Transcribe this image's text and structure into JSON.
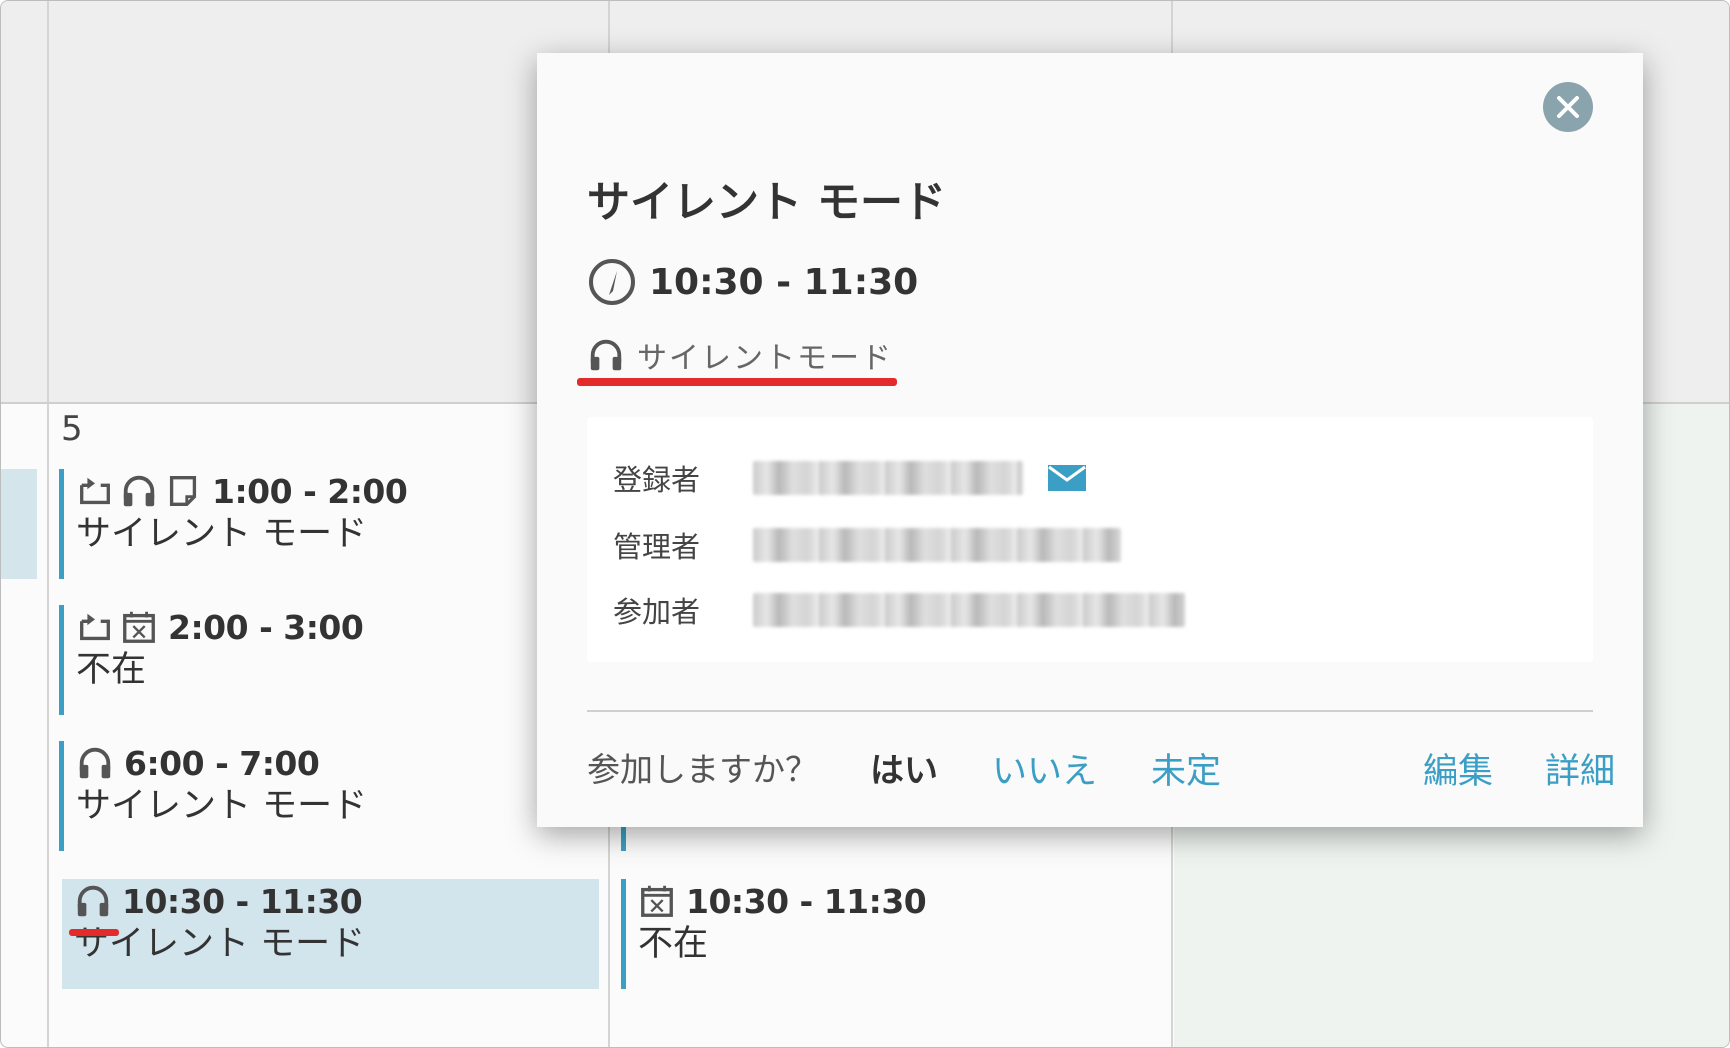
{
  "calendar": {
    "day_number": "5",
    "events_col1": [
      {
        "time": "1:00 - 2:00",
        "title": "サイレント モード",
        "icons": [
          "repeat-icon",
          "headphones-icon",
          "memo-icon"
        ]
      },
      {
        "time": "2:00 - 3:00",
        "title": "不在",
        "icons": [
          "repeat-icon",
          "calendar-x-icon"
        ]
      },
      {
        "time": "6:00 - 7:00",
        "title": "サイレント モード",
        "icons": [
          "headphones-icon"
        ]
      },
      {
        "time": "10:30 - 11:30",
        "title": "サイレント モード",
        "icons": [
          "headphones-icon"
        ],
        "selected": true
      }
    ],
    "events_col2": [
      {
        "time": "10:30 - 11:30",
        "title": "不在",
        "icons": [
          "calendar-x-icon"
        ]
      }
    ]
  },
  "popup": {
    "title": "サイレント モード",
    "time": "10:30 - 11:30",
    "facility": "サイレントモード",
    "info": {
      "registrant_label": "登録者",
      "manager_label": "管理者",
      "participant_label": "参加者"
    },
    "footer": {
      "question": "参加しますか？",
      "yes": "はい",
      "no": "いいえ",
      "undecided": "未定",
      "edit": "編集",
      "details": "詳細"
    }
  },
  "colors": {
    "accent": "#3b9fc5",
    "highlight": "#e32b2b",
    "selected_bg": "#d2e4ec",
    "close_button": "#8aa4ad"
  }
}
